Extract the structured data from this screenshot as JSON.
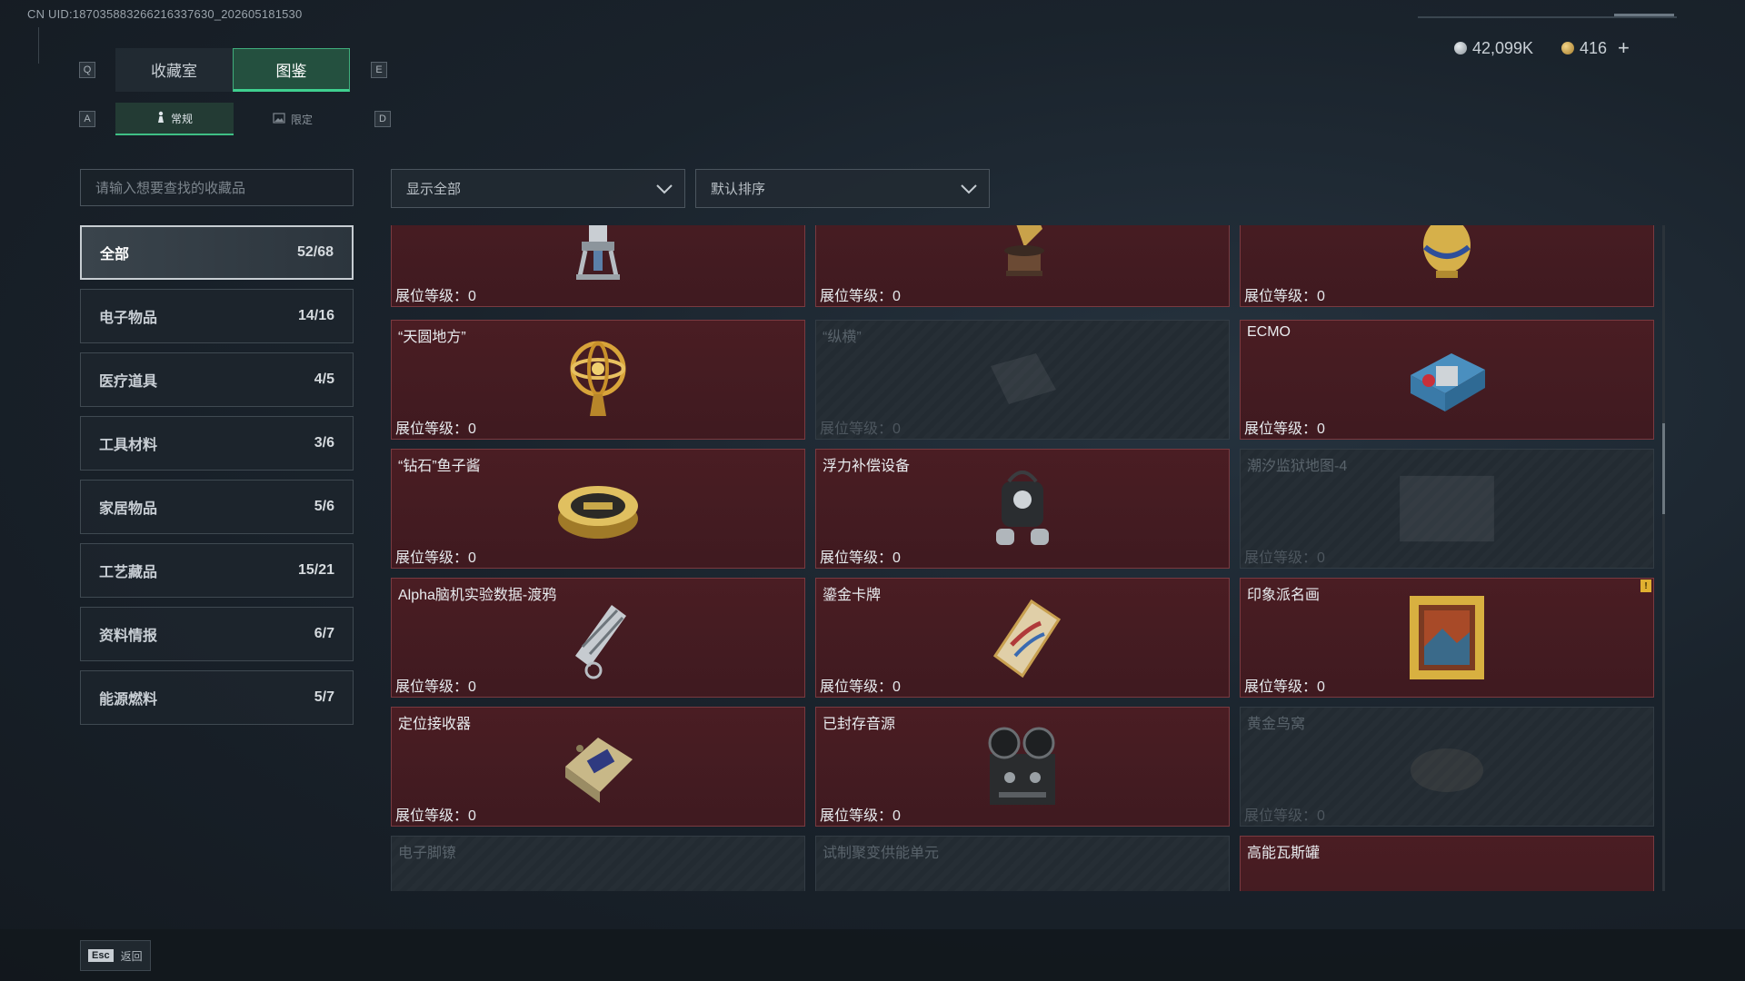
{
  "header": {
    "uid": "CN UID:187035883266216337630_202605181530",
    "currency": [
      {
        "icon": "silver-coin-icon",
        "value": "42,099K"
      },
      {
        "icon": "gold-coin-icon",
        "value": "416"
      }
    ],
    "plus_label": "+"
  },
  "keys": {
    "tab_left": "Q",
    "tab_right": "E",
    "sub_left": "A",
    "sub_right": "D"
  },
  "tabs": [
    {
      "label": "收藏室",
      "active": false
    },
    {
      "label": "图鉴",
      "active": true
    }
  ],
  "subtabs": [
    {
      "label": "常规",
      "icon": "figure-icon",
      "active": true
    },
    {
      "label": "限定",
      "icon": "image-icon",
      "active": false
    }
  ],
  "search": {
    "placeholder": "请输入想要查找的收藏品"
  },
  "filters": {
    "show": "显示全部",
    "sort": "默认排序"
  },
  "categories": [
    {
      "name": "全部",
      "count": "52/68",
      "active": true
    },
    {
      "name": "电子物品",
      "count": "14/16"
    },
    {
      "name": "医疗道具",
      "count": "4/5"
    },
    {
      "name": "工具材料",
      "count": "3/6"
    },
    {
      "name": "家居物品",
      "count": "5/6"
    },
    {
      "name": "工艺藏品",
      "count": "15/21"
    },
    {
      "name": "资料情报",
      "count": "6/7"
    },
    {
      "name": "能源燃料",
      "count": "5/7"
    }
  ],
  "level_label": "展位等级：0",
  "items": [
    {
      "name": "",
      "icon": "robot-arm-icon",
      "locked": false
    },
    {
      "name": "",
      "icon": "gramophone-icon",
      "locked": false
    },
    {
      "name": "",
      "icon": "golden-egg-icon",
      "locked": false
    },
    {
      "name": "“天圆地方”",
      "icon": "armillary-sphere-icon",
      "locked": false
    },
    {
      "name": "“纵横”",
      "icon": "board-icon",
      "locked": true
    },
    {
      "name": "ECMO",
      "icon": "ecmo-machine-icon",
      "locked": false
    },
    {
      "name": "“钻石”鱼子酱",
      "icon": "caviar-tin-icon",
      "locked": false
    },
    {
      "name": "浮力补偿设备",
      "icon": "diving-gear-icon",
      "locked": false
    },
    {
      "name": "潮汐监狱地图-4",
      "icon": "map-icon",
      "locked": true
    },
    {
      "name": "Alpha脑机实验数据-渡鸦",
      "icon": "data-cylinder-icon",
      "locked": false
    },
    {
      "name": "鎏金卡牌",
      "icon": "gilded-card-icon",
      "locked": false
    },
    {
      "name": "印象派名画",
      "icon": "framed-painting-icon",
      "locked": false,
      "badge": "!"
    },
    {
      "name": "定位接收器",
      "icon": "receiver-icon",
      "locked": false
    },
    {
      "name": "已封存音源",
      "icon": "reel-recorder-icon",
      "locked": false
    },
    {
      "name": "黄金鸟窝",
      "icon": "golden-nest-icon",
      "locked": true
    },
    {
      "name": "电子脚镣",
      "icon": "ankle-monitor-icon",
      "locked": true
    },
    {
      "name": "试制聚变供能单元",
      "icon": "fusion-unit-icon",
      "locked": true
    },
    {
      "name": "高能瓦斯罐",
      "icon": "gas-canister-icon",
      "locked": false
    }
  ],
  "footer": {
    "esc_key": "Esc",
    "esc_label": "返回"
  }
}
